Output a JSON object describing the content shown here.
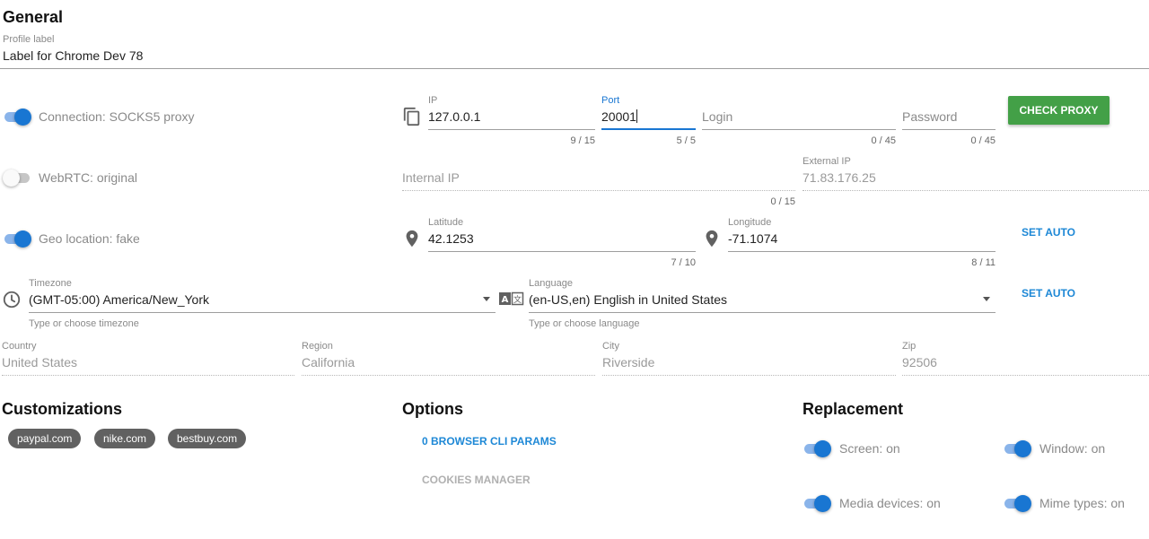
{
  "general": {
    "title": "General",
    "profile_label": {
      "label": "Profile label",
      "value": "Label for Chrome Dev 78"
    }
  },
  "connection": {
    "toggle_label": "Connection: SOCKS5 proxy",
    "ip": {
      "label": "IP",
      "value": "127.0.0.1",
      "counter": "9 / 15"
    },
    "port": {
      "label": "Port",
      "value": "20001",
      "counter": "5 / 5"
    },
    "login": {
      "placeholder": "Login",
      "counter": "0 / 45"
    },
    "password": {
      "placeholder": "Password",
      "counter": "0 / 45"
    },
    "check_button": "CHECK PROXY"
  },
  "webrtc": {
    "toggle_label": "WebRTC: original",
    "internal_ip": {
      "placeholder": "Internal IP",
      "counter": "0 / 15"
    },
    "external_ip": {
      "label": "External IP",
      "value": "71.83.176.25"
    }
  },
  "geo": {
    "toggle_label": "Geo location: fake",
    "latitude": {
      "label": "Latitude",
      "value": "42.1253",
      "counter": "7 / 10"
    },
    "longitude": {
      "label": "Longitude",
      "value": "-71.1074",
      "counter": "8 / 11"
    },
    "set_auto": "SET AUTO"
  },
  "timezone": {
    "label": "Timezone",
    "value": "(GMT-05:00) America/New_York",
    "hint": "Type or choose timezone"
  },
  "language": {
    "label": "Language",
    "value": "(en-US,en) English in United States",
    "hint": "Type or choose language",
    "set_auto": "SET AUTO"
  },
  "location": {
    "country": {
      "label": "Country",
      "value": "United States"
    },
    "region": {
      "label": "Region",
      "value": "California"
    },
    "city": {
      "label": "City",
      "value": "Riverside"
    },
    "zip": {
      "label": "Zip",
      "value": "92506"
    }
  },
  "customizations": {
    "title": "Customizations",
    "chips": [
      "paypal.com",
      "nike.com",
      "bestbuy.com"
    ]
  },
  "options": {
    "title": "Options",
    "cli_params": "0 BROWSER CLI PARAMS",
    "cookies_manager": "COOKIES MANAGER"
  },
  "replacement": {
    "title": "Replacement",
    "screen": "Screen: on",
    "window": "Window: on",
    "media_devices": "Media devices: on",
    "mime_types": "Mime types: on"
  },
  "colors": {
    "accent": "#1976d2",
    "check_proxy": "#43a047",
    "chip": "#616161"
  }
}
